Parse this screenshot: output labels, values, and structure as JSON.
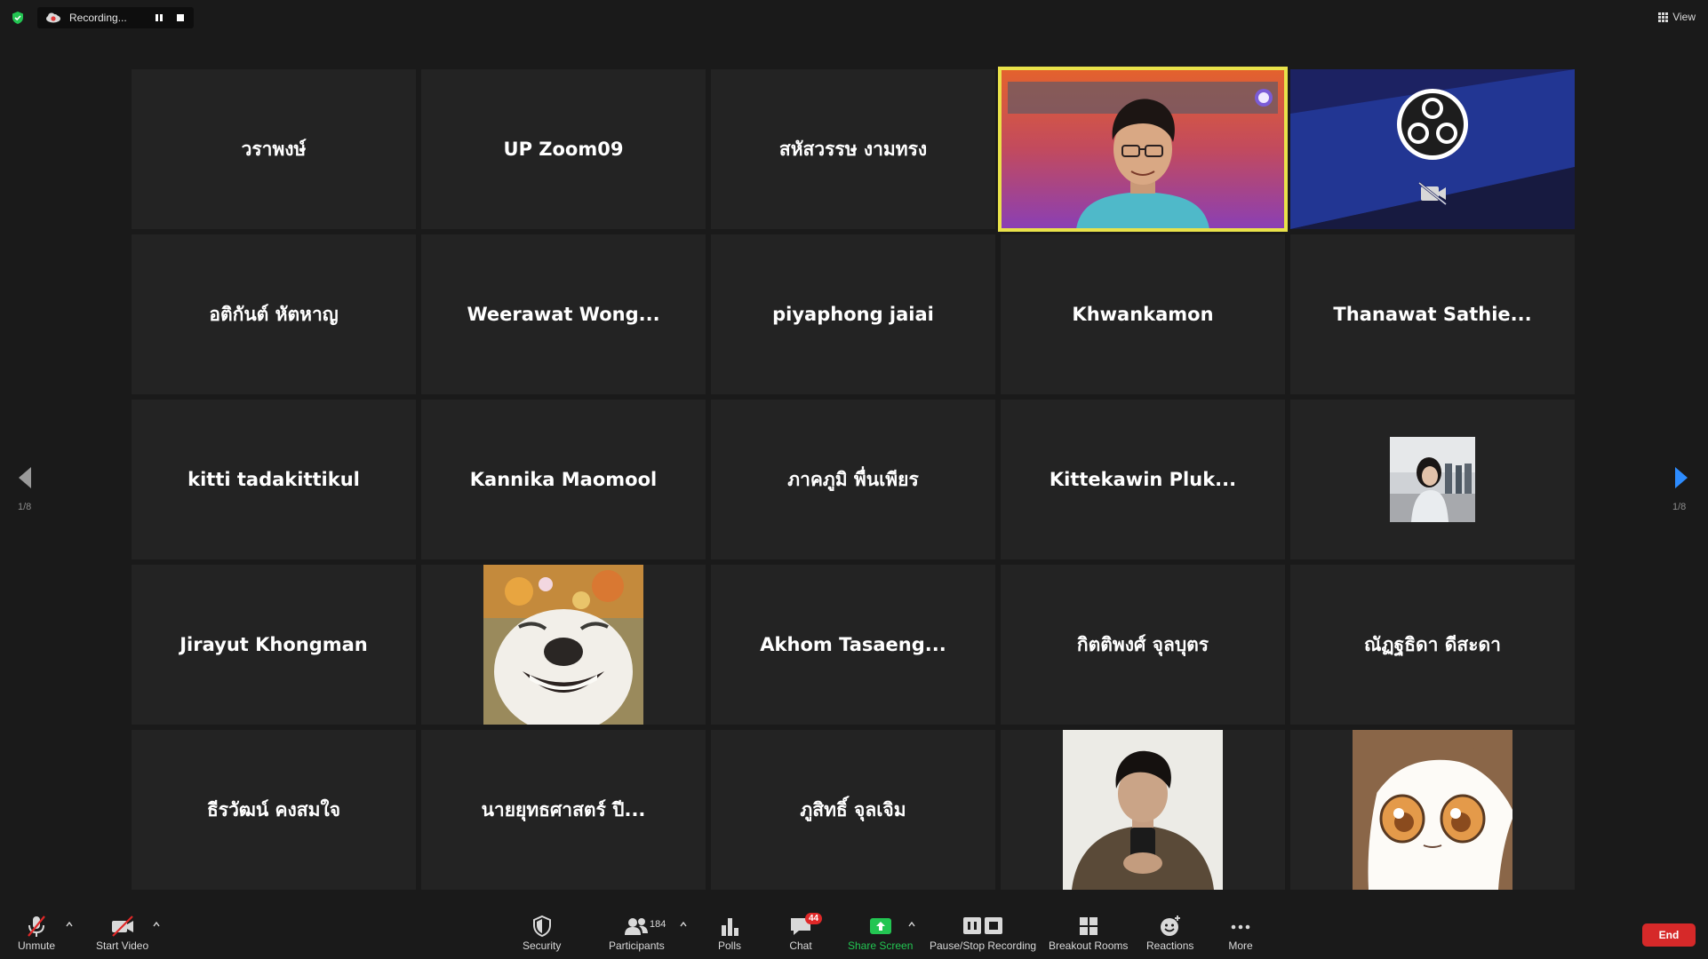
{
  "top_bar": {
    "recording_label": "Recording...",
    "view_label": "View"
  },
  "gallery": {
    "page_left": "1/8",
    "page_right": "1/8",
    "tiles": [
      {
        "name": "วราพงษ์"
      },
      {
        "name": "UP Zoom09"
      },
      {
        "name": "สหัสวรรษ งามทรง"
      },
      {
        "name": "",
        "type": "video-presenter"
      },
      {
        "name": "",
        "type": "obs-logo"
      },
      {
        "name": "อติกันต์ หัตหาญ"
      },
      {
        "name": "Weerawat  Wong..."
      },
      {
        "name": "piyaphong jaiai"
      },
      {
        "name": "Khwankamon"
      },
      {
        "name": "Thanawat  Sathie..."
      },
      {
        "name": "kitti tadakittikul"
      },
      {
        "name": "Kannika Maomool"
      },
      {
        "name": "ภาคภูมิ พื่นเพียร"
      },
      {
        "name": "Kittekawin  Pluk..."
      },
      {
        "name": "",
        "type": "photo-girl"
      },
      {
        "name": "Jirayut Khongman"
      },
      {
        "name": "",
        "type": "photo-dog"
      },
      {
        "name": "Akhom  Tasaeng..."
      },
      {
        "name": "กิตติพงศ์ จุลบุตร"
      },
      {
        "name": "ณัฏฐธิดา ดีสะดา"
      },
      {
        "name": "ธีรวัฒน์ คงสมใจ"
      },
      {
        "name": "นายยุทธศาสตร์ ปี..."
      },
      {
        "name": "ภูสิทธิ์ จุลเจิม"
      },
      {
        "name": "",
        "type": "photo-boy"
      },
      {
        "name": "",
        "type": "anime-avatar"
      }
    ]
  },
  "toolbar": {
    "unmute": "Unmute",
    "start_video": "Start Video",
    "security": "Security",
    "participants": "Participants",
    "participants_count": "184",
    "polls": "Polls",
    "chat": "Chat",
    "chat_badge": "44",
    "share_screen": "Share Screen",
    "pause_stop_recording": "Pause/Stop Recording",
    "breakout_rooms": "Breakout Rooms",
    "reactions": "Reactions",
    "more": "More",
    "end": "End"
  },
  "colors": {
    "active_speaker_border": "#e9e24a",
    "share_green": "#23c552",
    "end_red": "#d62929",
    "nav_arrow_blue": "#2d8cff"
  }
}
